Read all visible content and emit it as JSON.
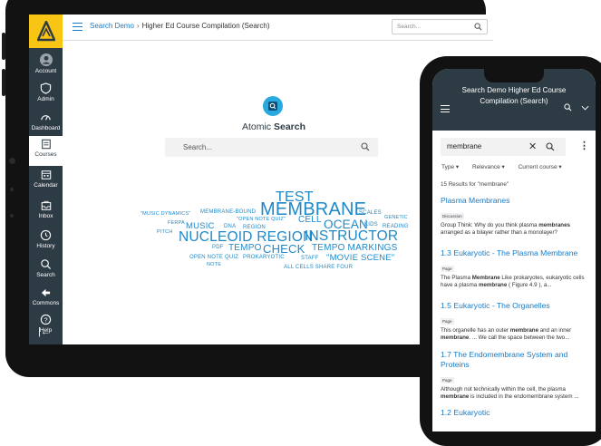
{
  "tablet": {
    "nav": [
      {
        "label": "Account",
        "icon": "account-icon"
      },
      {
        "label": "Admin",
        "icon": "admin-icon"
      },
      {
        "label": "Dashboard",
        "icon": "dashboard-icon"
      },
      {
        "label": "Courses",
        "icon": "courses-icon"
      },
      {
        "label": "Calendar",
        "icon": "calendar-icon"
      },
      {
        "label": "Inbox",
        "icon": "inbox-icon"
      },
      {
        "label": "History",
        "icon": "history-icon"
      },
      {
        "label": "Search",
        "icon": "search-icon"
      },
      {
        "label": "Commons",
        "icon": "commons-icon"
      },
      {
        "label": "Help",
        "icon": "help-icon"
      }
    ],
    "breadcrumb": {
      "root": "Search Demo",
      "separator": "›",
      "current": "Higher Ed Course Compilation (Search)"
    },
    "top_search_placeholder": "Search...",
    "atomic": {
      "title_plain": "Atomic ",
      "title_bold": "Search"
    },
    "main_search_placeholder": "Search...",
    "word_cloud": [
      "TEST",
      "\"MUSIC DYNAMICS\"",
      "MEMBRANE-BOUND",
      "MEMBRANE",
      "SCALES",
      "\"OPEN NOTE QUIZ\"",
      "GENETIC",
      "FERPA",
      "MUSIC",
      "DNA",
      "REGION",
      "CELL",
      "OCEAN",
      "KIDS",
      "READING",
      "PITCH",
      "NUCLEOID REGION",
      "INSTRUCTOR",
      "PDF",
      "TEMPO",
      "CHECK",
      "TEMPO MARKINGS",
      "OPEN NOTE QUIZ",
      "PROKARYOTIC",
      "STAFF",
      "\"MOVIE SCENE\"",
      "NOTE",
      "ALL CELLS SHARE FOUR"
    ]
  },
  "phone": {
    "title": "Search Demo Higher Ed Course Compilation (Search)",
    "search_value": "membrane",
    "filters": [
      "Type ▾",
      "Relevance ▾",
      "Current course ▾"
    ],
    "result_count": "15 Results for \"membrane\"",
    "results": [
      {
        "title": "Plasma Membranes",
        "tag": "Discussion",
        "snippet_parts": [
          "Group Think: Why do you think plasma ",
          "membranes",
          " arranged as a bilayer rather than a monolayer?"
        ]
      },
      {
        "title": "1.3 Eukaryotic - The Plasma Membrane",
        "tag": "Page",
        "snippet_parts": [
          " The Plasma ",
          "Membrane",
          " Like prokaryotes, eukaryotic cells have a  plasma ",
          "membrane",
          " ( Figure 4.9 ), a..."
        ]
      },
      {
        "title": "1.5 Eukaryotic - The Organelles",
        "tag": "Page",
        "snippet_parts": [
          "This organelle has an outer ",
          "membrane",
          " and an inner ",
          "membrane",
          ". ... We call the space between the two..."
        ]
      },
      {
        "title": "1.7 The Endomembrane System and Proteins",
        "tag": "Page",
        "snippet_parts": [
          "Although not technically  within the cell, the plasma ",
          "membrane",
          " is included in the endomembrane system ..."
        ]
      },
      {
        "title": "1.2 Eukaryotic",
        "tag": "",
        "snippet_parts": []
      }
    ]
  },
  "colors": {
    "nav_bg": "#2d3b45",
    "brand_yellow": "#f9c515",
    "link_blue": "#1a7ac4",
    "cloud_blue": "#1e88c8",
    "atomic_icon": "#2aa8e0"
  }
}
